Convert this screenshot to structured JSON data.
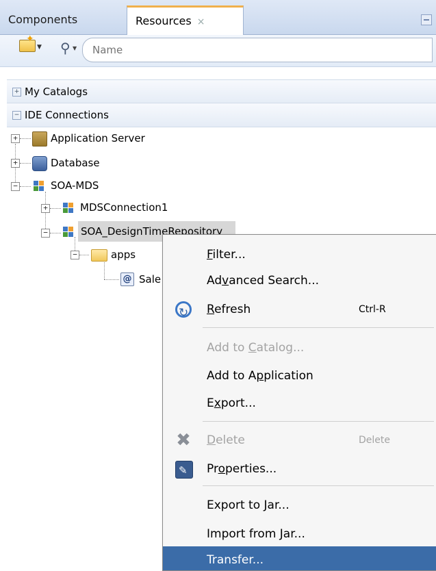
{
  "tabs": [
    {
      "label": "Components"
    },
    {
      "label": "Resources",
      "close": "×"
    }
  ],
  "toolbar": {
    "search_placeholder": "Name"
  },
  "sections": {
    "my_catalogs": {
      "toggle": "+",
      "label": "My Catalogs"
    },
    "ide_connections": {
      "toggle": "−",
      "label": "IDE Connections"
    }
  },
  "tree": {
    "application_server": "Application Server",
    "database": "Database",
    "soa_mds": "SOA-MDS",
    "mds_connection": "MDSConnection1",
    "soa_repo": "SOA_DesignTimeRepository",
    "apps": "apps",
    "sale": "Sale"
  },
  "context_menu": {
    "filter": {
      "pre": "",
      "u": "F",
      "post": "ilter..."
    },
    "advanced_search": {
      "pre": "Ad",
      "u": "v",
      "post": "anced Search..."
    },
    "refresh": {
      "pre": "",
      "u": "R",
      "post": "efresh",
      "shortcut": "Ctrl-R"
    },
    "add_to_catalog": {
      "pre": "Add to ",
      "u": "C",
      "post": "atalog..."
    },
    "add_to_application": {
      "pre": "Add to A",
      "u": "p",
      "post": "plication"
    },
    "export": {
      "pre": "E",
      "u": "x",
      "post": "port..."
    },
    "delete": {
      "pre": "",
      "u": "D",
      "post": "elete",
      "shortcut": "Delete"
    },
    "properties": {
      "pre": "Pr",
      "u": "o",
      "post": "perties..."
    },
    "export_to_jar": "Export to Jar...",
    "import_from_jar": "Import from Jar...",
    "transfer": "Transfer..."
  },
  "colors": {
    "highlight": "#3b6ca8",
    "tab_accent": "#f0b04c"
  }
}
